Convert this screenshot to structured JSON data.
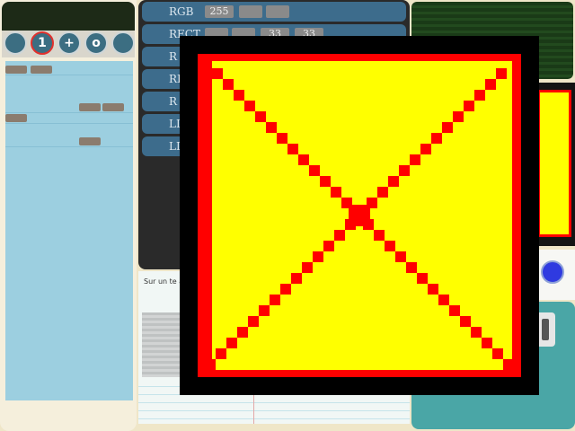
{
  "colors": {
    "accent_red": "#ff0000",
    "preview_fill": "#ffff00",
    "button_blue": "#3c6e82",
    "command_blue": "#3d6c8c"
  },
  "toolbar": {
    "buttons": [
      {
        "name": "dot-icon",
        "glyph": ""
      },
      {
        "name": "number-one-icon",
        "glyph": "1"
      },
      {
        "name": "plus-icon",
        "glyph": "+"
      },
      {
        "name": "ring-icon",
        "glyph": "o"
      },
      {
        "name": "dot-icon",
        "glyph": ""
      }
    ]
  },
  "commands": {
    "rgb": {
      "label": "RGB",
      "value": "255"
    },
    "rect": {
      "label": "RECT",
      "x": "33",
      "y": "33"
    },
    "row3": {
      "label": "R"
    },
    "row4": {
      "label": "RE"
    },
    "row5": {
      "label": "R"
    },
    "row6": {
      "label": "LI"
    },
    "row7": {
      "label": "LI"
    }
  },
  "lower_text": "Sur un te aleó que"
}
